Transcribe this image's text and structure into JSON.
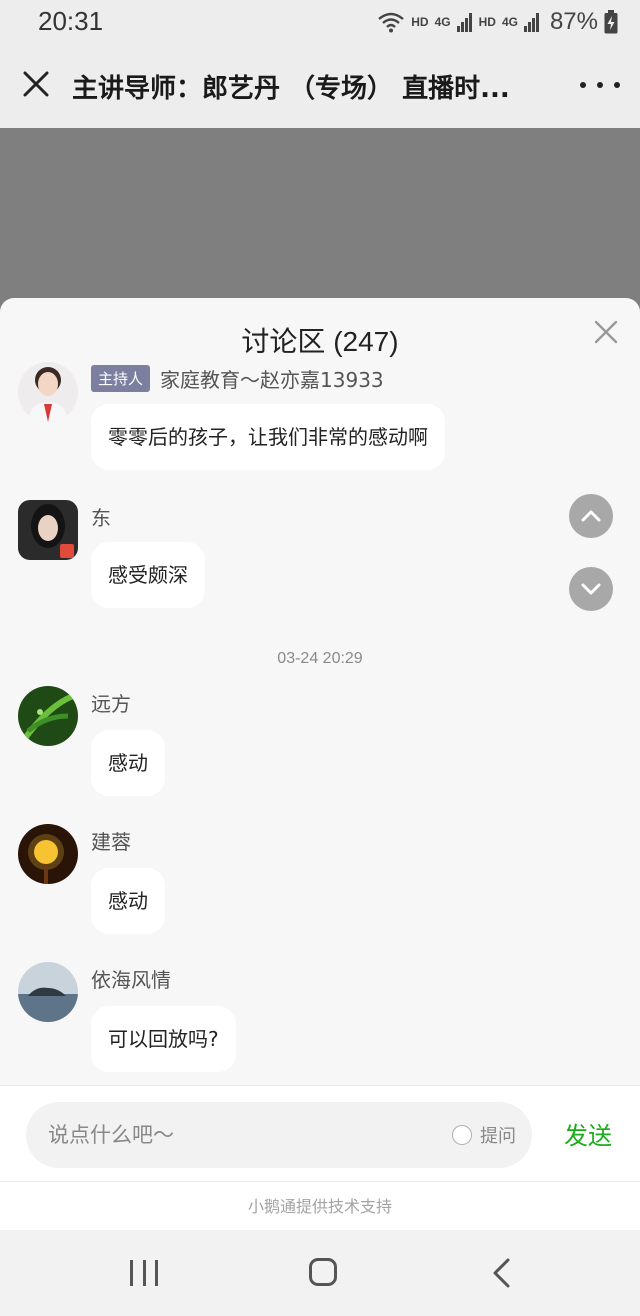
{
  "status_bar": {
    "time": "20:31",
    "network_labels": [
      "HD",
      "4G",
      "HD",
      "4G"
    ],
    "battery": "87%"
  },
  "title_bar": {
    "title": "主讲导师：郎艺丹 （专场） 直播时..."
  },
  "discussion": {
    "header": "讨论区 (247)",
    "messages": [
      {
        "badge": "主持人",
        "name": "家庭教育～赵亦嘉13933",
        "text": "零零后的孩子，让我们非常的感动啊",
        "avatar_icon": "woman-portrait-avatar"
      },
      {
        "name": "东 ",
        "text": "感受颇深",
        "avatar_icon": "woman-dark-hair-avatar"
      },
      {
        "name": "远方",
        "text": "感动",
        "avatar_icon": "green-leaf-avatar"
      },
      {
        "name": "建蓉",
        "text": "感动",
        "avatar_icon": "lamp-avatar"
      },
      {
        "name": "依海风情",
        "text": "可以回放吗?",
        "avatar_icon": "island-avatar"
      }
    ],
    "time_separator": "03-24 20:29"
  },
  "input": {
    "placeholder": "说点什么吧～",
    "question_label": "提问",
    "send_label": "发送"
  },
  "support_text": "小鹅通提供技术支持",
  "colors": {
    "send_green": "#1aad19",
    "host_badge": "#7c7fa0",
    "sheet_bg": "#f7f7f7"
  }
}
